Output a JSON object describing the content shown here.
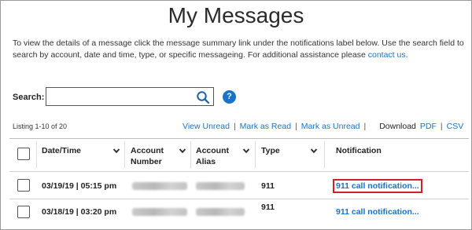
{
  "page": {
    "title": "My Messages",
    "intro_text": "To view the details of a message click the message summary link under the notifications label below. Use the search field to search by account, date and time, type, or specific messageing. For additional assistance please ",
    "contact_link": "contact us",
    "intro_end": "."
  },
  "search": {
    "label": "Search:",
    "value": "",
    "placeholder": "",
    "help_label": "?"
  },
  "listing": {
    "summary": "Listing 1-10 of 20"
  },
  "actions": {
    "view_unread": "View Unread",
    "mark_read": "Mark as Read",
    "mark_unread": "Mark as Unread",
    "separator": "|",
    "download_label": "Download",
    "pdf": "PDF",
    "csv": "CSV"
  },
  "table": {
    "columns": {
      "datetime": "Date/Time",
      "account_number_line1": "Account",
      "account_number_line2": "Number",
      "account_alias_line1": "Account",
      "account_alias_line2": "Alias",
      "type": "Type",
      "notification": "Notification"
    },
    "rows": [
      {
        "datetime": "03/19/19 | 05:15 pm",
        "type": "911",
        "notification": "911 call notification...",
        "highlighted": true
      },
      {
        "datetime": "03/18/19 | 03:20 pm",
        "type": "911",
        "notification": "911 call notification...",
        "highlighted": false
      }
    ]
  },
  "colors": {
    "link": "#1a73c5",
    "highlight_border": "#d21f2a"
  }
}
